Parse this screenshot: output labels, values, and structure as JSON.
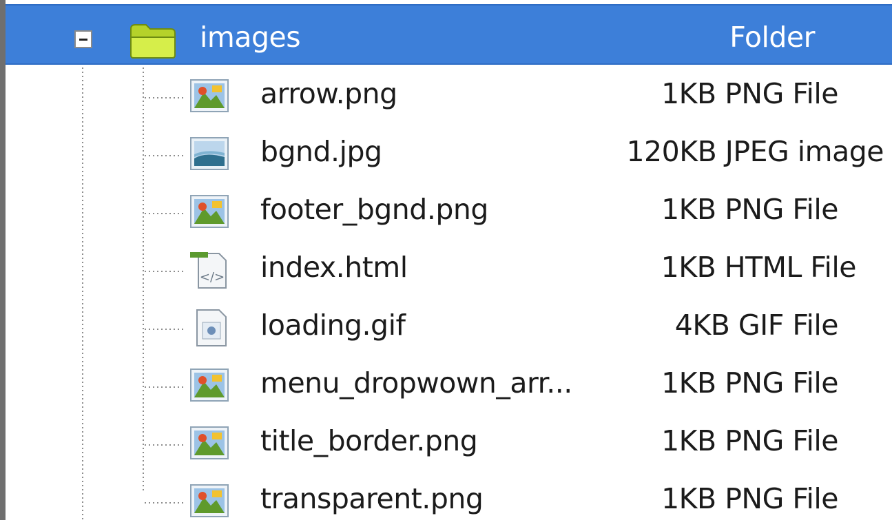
{
  "folder": {
    "name": "images",
    "type": "Folder",
    "icon": "folder-icon",
    "expanded": true
  },
  "files": [
    {
      "name": "arrow.png",
      "size_type": "1KB PNG File",
      "icon": "png-image-icon"
    },
    {
      "name": "bgnd.jpg",
      "size_type": "120KB JPEG image",
      "icon": "jpeg-image-icon"
    },
    {
      "name": "footer_bgnd.png",
      "size_type": "1KB PNG File",
      "icon": "png-image-icon"
    },
    {
      "name": "index.html",
      "size_type": "1KB HTML File",
      "icon": "html-file-icon"
    },
    {
      "name": "loading.gif",
      "size_type": "4KB GIF File",
      "icon": "gif-file-icon"
    },
    {
      "name": "menu_dropwown_arr...",
      "size_type": "1KB PNG File",
      "icon": "png-image-icon"
    },
    {
      "name": "title_border.png",
      "size_type": "1KB PNG File",
      "icon": "png-image-icon"
    },
    {
      "name": "transparent.png",
      "size_type": "1KB PNG File",
      "icon": "png-image-icon"
    }
  ],
  "colors": {
    "selection": "#3d7fd9",
    "selection_text": "#ffffff",
    "text": "#1b1b1b"
  }
}
